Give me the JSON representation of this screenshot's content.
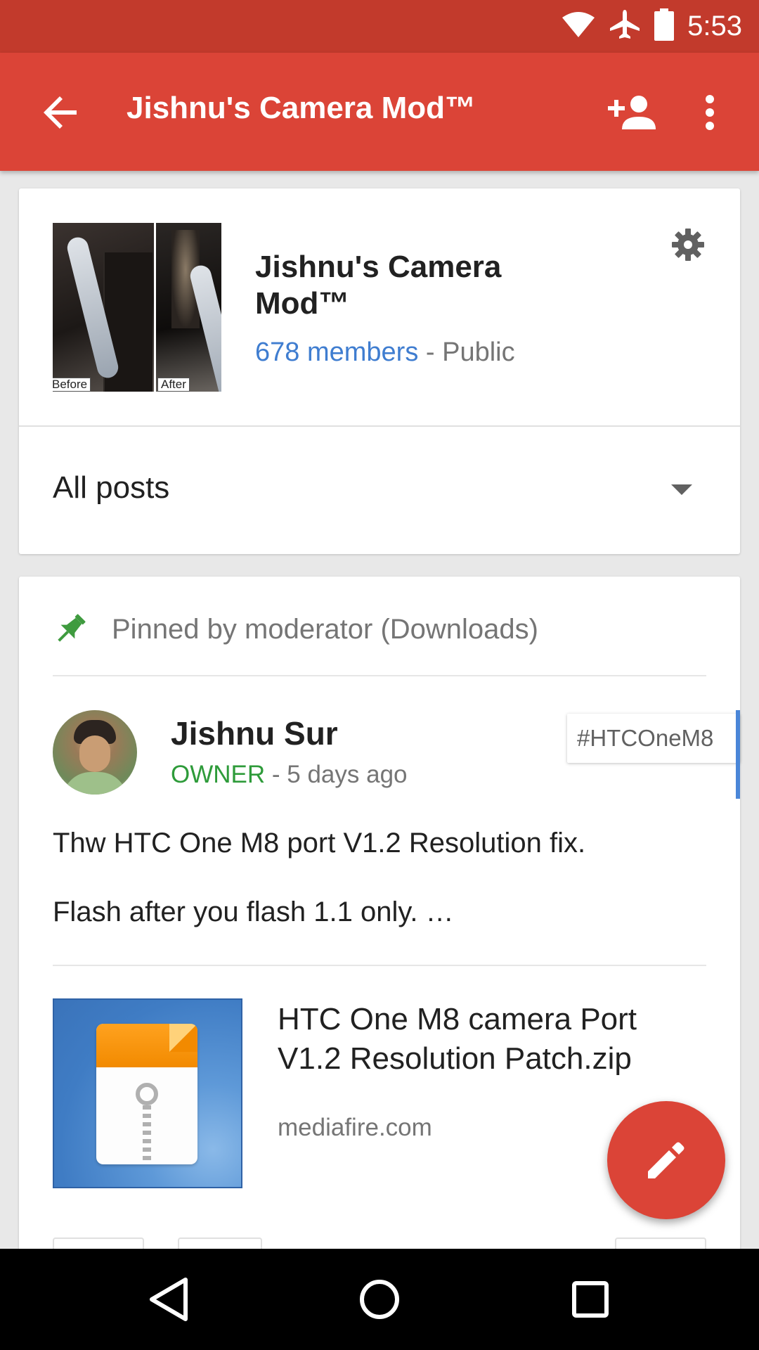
{
  "status_bar": {
    "time": "5:53",
    "icons": [
      "wifi-icon",
      "airplane-icon",
      "battery-icon"
    ]
  },
  "app_bar": {
    "title": "Jishnu's Camera Mod™",
    "icons": [
      "back-arrow-icon",
      "add-person-icon",
      "overflow-menu-icon"
    ]
  },
  "community": {
    "name": "Jishnu's Camera Mod™",
    "members": "678 members",
    "separator": " - ",
    "visibility": "Public",
    "thumb_before_label": "Before",
    "thumb_after_label": "After",
    "settings_icon": "gear-icon"
  },
  "filter": {
    "selected": "All posts"
  },
  "post": {
    "pinned_text": "Pinned by moderator (Downloads)",
    "author": "Jishnu Sur",
    "role": "OWNER",
    "time": " - 5 days ago",
    "hashtag": "#HTCOneM8",
    "body": [
      "Thw HTC One M8 port V1.2 Resolution fix.",
      "Flash after you flash 1.1 only. …"
    ],
    "attachment": {
      "title": "HTC One M8 camera Port V1.2 Resolution Patch.zip",
      "domain": "mediafire.com"
    }
  },
  "fab": {
    "icon": "pencil-icon"
  },
  "nav_bar": {
    "icons": [
      "nav-back-icon",
      "nav-home-icon",
      "nav-recents-icon"
    ]
  },
  "colors": {
    "status_bar": "#c23a2c",
    "app_bar": "#db4437",
    "link_blue": "#3f7dd0",
    "owner_green": "#2e9b3a"
  }
}
